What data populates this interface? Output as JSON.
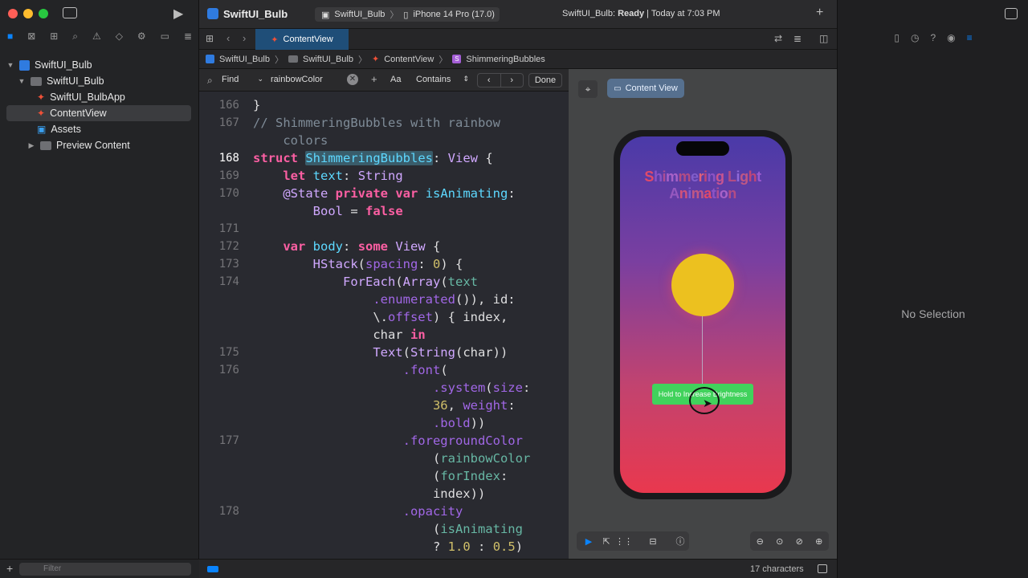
{
  "window": {
    "project_title": "SwiftUI_Bulb",
    "scheme": "SwiftUI_Bulb",
    "device": "iPhone 14 Pro (17.0)",
    "status_prefix": "SwiftUI_Bulb: ",
    "status_state": "Ready",
    "status_time": " | Today at 7:03 PM"
  },
  "navigator": {
    "items": [
      {
        "label": "SwiftUI_Bulb"
      },
      {
        "label": "SwiftUI_Bulb"
      },
      {
        "label": "SwiftUI_BulbApp"
      },
      {
        "label": "ContentView"
      },
      {
        "label": "Assets"
      },
      {
        "label": "Preview Content"
      }
    ],
    "filter_placeholder": "Filter"
  },
  "tabs": [
    {
      "label": "ContentView"
    }
  ],
  "breadcrumb": [
    "SwiftUI_Bulb",
    "SwiftUI_Bulb",
    "ContentView",
    "ShimmeringBubbles"
  ],
  "find": {
    "mode": "Find",
    "query": "rainbowColor",
    "case_label": "Aa",
    "match_mode": "Contains",
    "done_label": "Done"
  },
  "code_lines": [
    {
      "n": "166",
      "t": "}"
    },
    {
      "n": "167",
      "t": "// ShimmeringBubbles with rainbow"
    },
    {
      "n": "",
      "t": "    colors"
    },
    {
      "n": "168",
      "t": "struct ShimmeringBubbles: View {"
    },
    {
      "n": "169",
      "t": "    let text: String"
    },
    {
      "n": "170",
      "t": "    @State private var isAnimating:"
    },
    {
      "n": "",
      "t": "        Bool = false"
    },
    {
      "n": "171",
      "t": ""
    },
    {
      "n": "172",
      "t": "    var body: some View {"
    },
    {
      "n": "173",
      "t": "        HStack(spacing: 0) {"
    },
    {
      "n": "174",
      "t": "            ForEach(Array(text"
    },
    {
      "n": "",
      "t": "                .enumerated()), id:"
    },
    {
      "n": "",
      "t": "                \\.offset) { index,"
    },
    {
      "n": "",
      "t": "                char in"
    },
    {
      "n": "175",
      "t": "                Text(String(char))"
    },
    {
      "n": "176",
      "t": "                    .font("
    },
    {
      "n": "",
      "t": "                        .system(size:"
    },
    {
      "n": "",
      "t": "                        36, weight:"
    },
    {
      "n": "",
      "t": "                        .bold))"
    },
    {
      "n": "177",
      "t": "                    .foregroundColor"
    },
    {
      "n": "",
      "t": "                        (rainbowColor"
    },
    {
      "n": "",
      "t": "                        (forIndex:"
    },
    {
      "n": "",
      "t": "                        index))"
    },
    {
      "n": "178",
      "t": "                    .opacity"
    },
    {
      "n": "",
      "t": "                        (isAnimating"
    },
    {
      "n": "",
      "t": "                        ? 1.0 : 0.5)"
    }
  ],
  "preview": {
    "pill_label": "Content View",
    "title_text": "Shimmering Light Animation",
    "button_label": "Hold to Increase Brightness"
  },
  "inspector": {
    "empty_label": "No Selection"
  },
  "statusbar": {
    "char_count": "17 characters"
  },
  "colors": {
    "accent": "#0a84ff",
    "bulb": "#ecc11f",
    "button": "#41d25c",
    "gradient_top": "#4a3aa8",
    "gradient_bottom": "#e9384e"
  }
}
